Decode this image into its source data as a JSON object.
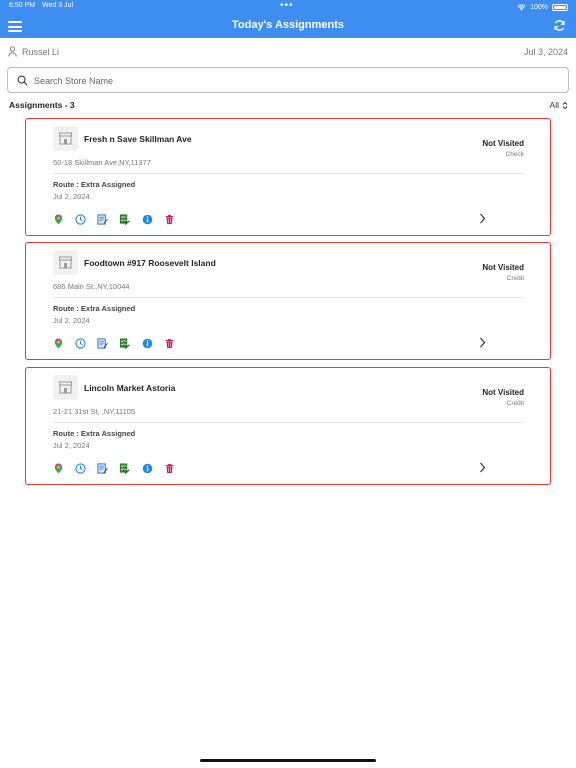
{
  "status_bar": {
    "time": "6:50 PM",
    "date": "Wed 3 Jul",
    "dots": "•••",
    "battery": "100%"
  },
  "header": {
    "title": "Today's Assignments"
  },
  "user": {
    "name": "Russel Li",
    "date": "Jul 3, 2024"
  },
  "search": {
    "placeholder": "Search Store Name",
    "value": ""
  },
  "assignments": {
    "count_label": "Assignments - 3",
    "filter_label": "All",
    "items": [
      {
        "store": "Fresh n Save Skillman Ave",
        "address": "50-18 Skillman Ave,NY,11377",
        "status": "Not Visited",
        "payment": "Check",
        "route": "Route :  Extra Assigned",
        "date": "Jul 2, 2024"
      },
      {
        "store": "Foodtown #917 Roosevelt Island",
        "address": "686 Main St.,NY,10044",
        "status": "Not Visited",
        "payment": "Credit",
        "route": "Route :  Extra Assigned",
        "date": "Jul 2, 2024"
      },
      {
        "store": "Lincoln Market Astoria",
        "address": "21-21 31st St, ,NY,11105",
        "status": "Not Visited",
        "payment": "Credit",
        "route": "Route :  Extra Assigned",
        "date": "Jul 2, 2024"
      }
    ]
  },
  "action_icons": [
    "map-pin-icon",
    "clock-icon",
    "notes-icon",
    "checklist-icon",
    "info-icon",
    "delete-icon"
  ],
  "colors": {
    "header": "#3d8ef0",
    "card_border": "#e53935",
    "delete": "#c2185b",
    "info": "#1e88e5"
  }
}
